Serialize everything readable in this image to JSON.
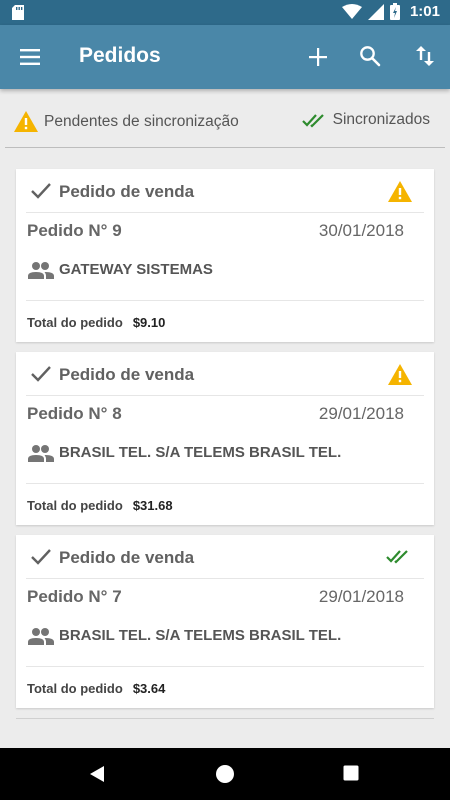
{
  "status_bar": {
    "time": "1:01"
  },
  "app_bar": {
    "title": "Pedidos"
  },
  "legend": {
    "pending": "Pendentes de sincronização",
    "synced": "Sincronizados"
  },
  "orders": [
    {
      "type": "Pedido de venda",
      "number": "Pedido N°  9",
      "date": "30/01/2018",
      "client": "GATEWAY SISTEMAS",
      "total_label": "Total do pedido",
      "total_value": "$9.10",
      "status": "pending"
    },
    {
      "type": "Pedido de venda",
      "number": "Pedido N°  8",
      "date": "29/01/2018",
      "client": "BRASIL TEL. S/A TELEMS BRASIL TEL.",
      "total_label": "Total do pedido",
      "total_value": "$31.68",
      "status": "pending"
    },
    {
      "type": "Pedido de venda",
      "number": "Pedido N°  7",
      "date": "29/01/2018",
      "client": "BRASIL TEL. S/A TELEMS BRASIL TEL.",
      "total_label": "Total do pedido",
      "total_value": "$3.64",
      "status": "synced"
    }
  ],
  "icons": {
    "pending": "warning-icon",
    "synced": "double-check-icon"
  },
  "colors": {
    "app_bar": "#4a87a8",
    "status_bar": "#2e6a8a",
    "warning": "#f5b400",
    "synced": "#2e8b2e"
  }
}
